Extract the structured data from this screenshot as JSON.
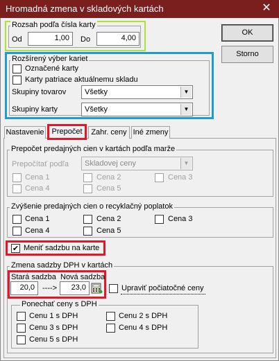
{
  "window": {
    "title": "Hromadná zmena v skladových kartách",
    "close": "✕"
  },
  "buttons": {
    "ok": "OK",
    "cancel": "Storno"
  },
  "range": {
    "label": "Rozsah podľa čísla karty",
    "from_label": "Od",
    "from_value": "1,00",
    "to_label": "Do",
    "to_value": "4,00"
  },
  "extended": {
    "label": "Rozšírený výber kariet",
    "marked_cards": "Označené karty",
    "current_warehouse": "Karty patriace aktuálnemu skladu",
    "goods_group_label": "Skupiny tovarov",
    "goods_group_value": "Všetky",
    "card_group_label": "Skupiny karty",
    "card_group_value": "Všetky"
  },
  "tabs": [
    "Nastavenie",
    "Prepočet",
    "Zahr. ceny",
    "Iné zmeny"
  ],
  "recalc": {
    "label": "Prepočet predajných cien v kartách podľa marže",
    "basis_label": "Prepočítať podľa",
    "basis_value": "Skladovej ceny",
    "prices": [
      "Cena 1",
      "Cena 2",
      "Cena 3",
      "Cena 4",
      "Cena 5"
    ]
  },
  "recycling": {
    "label": "Zvýšenie predajných cien o recyklačný poplatok",
    "prices": [
      "Cena 1",
      "Cena 2",
      "Cena 3",
      "Cena 4",
      "Cena 5"
    ]
  },
  "change_rate": {
    "label": "Meniť sadzbu na karte",
    "checked": true
  },
  "vat": {
    "label": "Zmena sadzby DPH v kartách",
    "old_label": "Stará sadzba",
    "new_label": "Nová sadzba",
    "old_value": "20,0",
    "arrow": "---->",
    "new_value": "23,0",
    "adjust_initial": "Upraviť počiatočné ceny",
    "keep_label": "Ponechať ceny s DPH",
    "keep_items": [
      "Cenu 1 s DPH",
      "Cenu 2 s DPH",
      "Cenu 3 s DPH",
      "Cenu 4 s DPH",
      "Cenu 5 s DPH"
    ]
  }
}
